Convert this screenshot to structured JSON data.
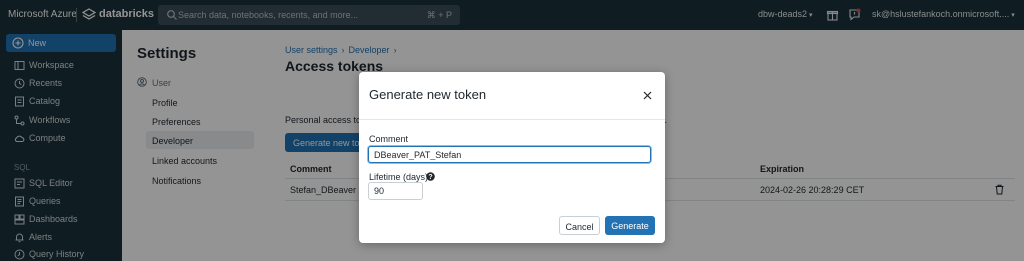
{
  "topbar": {
    "brand": "Microsoft Azure",
    "product": "databricks",
    "search_placeholder": "Search data, notebooks, recents, and more...",
    "search_shortcut": "⌘ + P",
    "workspace": "dbw-deads2",
    "user": "sk@hslustefankoch.onmicrosoft...."
  },
  "sidebar": {
    "new_label": "New",
    "items": [
      {
        "label": "Workspace",
        "icon": "folder-icon"
      },
      {
        "label": "Recents",
        "icon": "clock-icon"
      },
      {
        "label": "Catalog",
        "icon": "catalog-icon"
      },
      {
        "label": "Workflows",
        "icon": "workflows-icon"
      },
      {
        "label": "Compute",
        "icon": "cloud-icon"
      }
    ],
    "sql_header": "SQL",
    "sql_items": [
      {
        "label": "SQL Editor",
        "icon": "sql-editor-icon"
      },
      {
        "label": "Queries",
        "icon": "queries-icon"
      },
      {
        "label": "Dashboards",
        "icon": "dashboards-icon"
      },
      {
        "label": "Alerts",
        "icon": "bell-icon"
      },
      {
        "label": "Query History",
        "icon": "history-icon"
      }
    ]
  },
  "settings": {
    "title": "Settings",
    "user_section": "User",
    "nav": [
      "Profile",
      "Preferences",
      "Developer",
      "Linked accounts",
      "Notifications"
    ],
    "active": "Developer"
  },
  "main": {
    "breadcrumb": [
      "User settings",
      "Developer"
    ],
    "title": "Access tokens",
    "description": "Personal access tok",
    "description_end": "ds.",
    "generate_button": "Generate new token",
    "columns": [
      "Comment",
      "Expiration"
    ],
    "rows": [
      {
        "comment": "Stefan_DBeaver",
        "expiration": "2024-02-26 20:28:29 CET"
      }
    ]
  },
  "modal": {
    "title": "Generate new token",
    "comment_label": "Comment",
    "comment_value": "DBeaver_PAT_Stefan",
    "lifetime_label": "Lifetime (days)",
    "lifetime_value": "90",
    "cancel_label": "Cancel",
    "generate_label": "Generate"
  },
  "colors": {
    "topbar_bg": "#1b3139",
    "primary": "#2272b4"
  }
}
